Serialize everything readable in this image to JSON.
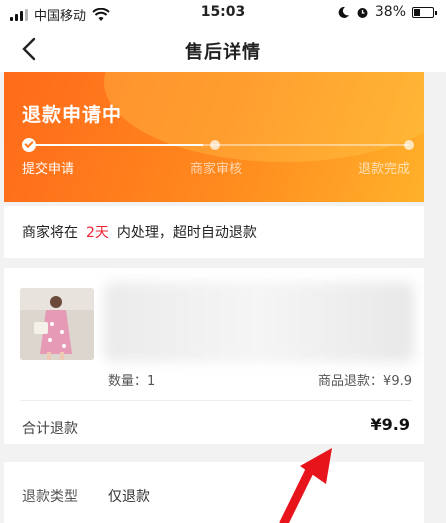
{
  "status_bar": {
    "carrier": "中国移动",
    "time": "15:03",
    "battery": "38%",
    "battery_level": 0.38
  },
  "nav": {
    "title": "售后详情",
    "back_icon": "chevron-left-icon"
  },
  "progress": {
    "title": "退款申请中",
    "steps": [
      {
        "label": "提交申请",
        "done": true
      },
      {
        "label": "商家审核",
        "done": false
      },
      {
        "label": "退款完成",
        "done": false
      }
    ]
  },
  "notice": {
    "prefix": "商家将在",
    "days": "2天",
    "suffix": "内处理，超时自动退款"
  },
  "product": {
    "quantity_label": "数量：1",
    "item_refund_label": "商品退款：¥9.9",
    "total_label": "合计退款",
    "total_value": "¥9.9"
  },
  "refund_type": {
    "label": "退款类型",
    "value": "仅退款"
  },
  "colors": {
    "accent": "#ff7a1e",
    "highlight_red": "#ee2233",
    "arrow_red": "#e8141c"
  }
}
